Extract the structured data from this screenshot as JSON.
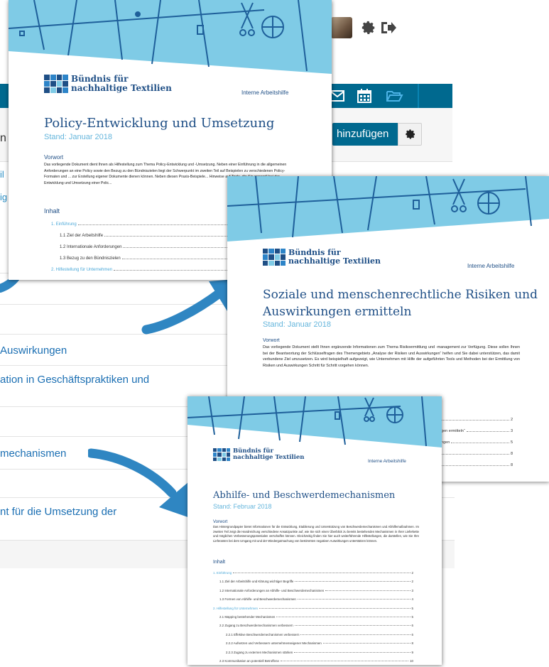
{
  "app": {
    "add_button_label": "hinzufügen",
    "frag_n": "n",
    "frag_il": "il",
    "frag_ig": "ig",
    "list_items": [
      " Auswirkungen",
      "ation in Geschäftspraktiken und",
      "mechanismen",
      "nt für die Umsetzung der"
    ],
    "icons": [
      "avatar",
      "gear-icon",
      "logout-icon",
      "mail-icon",
      "calendar-icon",
      "folder-open-icon",
      "gear-icon"
    ]
  },
  "doc1": {
    "brand_line1": "Bündnis für",
    "brand_line2": "nachhaltige Textilien",
    "label": "Interne Arbeitshilfe",
    "title": "Policy-Entwicklung und Umsetzung",
    "stand": "Stand: Januar 2018",
    "vorwort_heading": "Vorwort",
    "vorwort_text": "Das vorliegende Dokument dient Ihnen als Hilfestellung zum Thema Policy-Entwicklung und -Umsetzung. Neben einer Einführung in die allgemeinen Anforderungen an eine Policy sowie den Bezug zu den Bündniszielen liegt der Schwerpunkt im zweiten Teil auf Beispielen zu verschiedenen Policy-Formaten und ... zur Erstellung eigener Dokumente dienen können. Neben diesen Praxis-Beispiele... Hinweise auf Tools, die Sie generell bei der Entwicklung und Umsetzung einer Polic...",
    "inhalt_heading": "Inhalt",
    "toc": [
      {
        "label": "1. Einführung",
        "page": "",
        "chapter": true
      },
      {
        "label": "1.1 Ziel der Arbeitshilfe",
        "page": "",
        "chapter": false
      },
      {
        "label": "1.2 Internationale Anforderungen",
        "page": "",
        "chapter": false
      },
      {
        "label": "1.3 Bezug zu den Bündniszielen",
        "page": "",
        "chapter": false
      },
      {
        "label": "2. Hilfestellung für Unternehmen",
        "page": "",
        "chapter": true
      }
    ]
  },
  "doc2": {
    "brand_line1": "Bündnis für",
    "brand_line2": "nachhaltige Textilien",
    "label": "Interne Arbeitshilfe",
    "title_line1": "Soziale und menschenrechtliche Risiken und",
    "title_line2": "Auswirkungen ermitteln",
    "stand": "Stand: Januar 2018",
    "vorwort_heading": "Vorwort",
    "vorwort_text": "Das vorliegende Dokument stellt Ihnen ergänzende Informationen zum Thema Risikoermittlung und -management zur Verfügung. Diese sollen Ihnen bei der Beantwortung der Schlüsselfragen des Themengebiets „Analyse der Risiken und Auswirkungen“ helfen und Sie dabei unterstützen, das damit verbundene Ziel umzusetzen. Es wird beispielhaft aufgezeigt, wie Unternehmen mit Hilfe der aufgeführten Tools und Methoden bei der Ermittlung von Risiken und Auswirkungen Schritt für Schritt vorgehen können.",
    "toc_fragments": [
      {
        "label": "",
        "page": "2"
      },
      {
        "label": "ngen ermitteln“",
        "page": "3"
      },
      {
        "label": "ungen",
        "page": "5"
      },
      {
        "label": "",
        "page": "8"
      },
      {
        "label": "",
        "page": "8"
      }
    ]
  },
  "doc3": {
    "brand_line1": "Bündnis für",
    "brand_line2": "nachhaltige Textilien",
    "label": "Interne Arbeitshilfe",
    "title": "Abhilfe- und Beschwerdemechanismen",
    "stand": "Stand: Februar 2018",
    "vorwort_heading": "Vorwort",
    "vorwort_text": "Das Hintergrundpapier bietet Informationen für die Entwicklung, Etablierung und Unterstützung von Beschwerdemechanismen und Abhilfemaßnahmen. Im zweiten Teil zeigt die Handreichung verschiedene Ansatzpunkte auf, wie Sie sich einen Überblick zu bereits bestehenden Mechanismen in Ihrer Lieferkette und möglichen Verbesserungspotentialen verschaffen können. Gleichzeitig finden Sie hier auch weiterführende Hilfestellungen, die darstellen, wie Sie Ihre Lieferanten bei dem Umgang mit und der Wiedergutmachung von bestimmten negativen Auswirkungen unterstützen können.",
    "inhalt_heading": "Inhalt",
    "toc": [
      {
        "label": "1. Einführung",
        "page": "2",
        "chapter": true,
        "indent": 0
      },
      {
        "label": "1.1 Ziel der Arbeitshilfe und Klärung wichtiger Begriffe",
        "page": "2",
        "chapter": false,
        "indent": 1
      },
      {
        "label": "1.2 Internationale Anforderungen an Abhilfe- und Beschwerdemechanismen",
        "page": "3",
        "chapter": false,
        "indent": 1
      },
      {
        "label": "1.3 Formen von Abhilfe- und Beschwerdemechanismen",
        "page": "4",
        "chapter": false,
        "indent": 1
      },
      {
        "label": "2. Hilfestellung für Unternehmen",
        "page": "5",
        "chapter": true,
        "indent": 0
      },
      {
        "label": "2.1 Mapping bestehender Mechanismen",
        "page": "5",
        "chapter": false,
        "indent": 1
      },
      {
        "label": "2.2 Zugang zu Beschwerdemechanismen verbessern",
        "page": "6",
        "chapter": false,
        "indent": 1
      },
      {
        "label": "2.2.1 Effektive Beschwerdemechanismen verbessern",
        "page": "6",
        "chapter": false,
        "indent": 2
      },
      {
        "label": "2.2.2 Aufsetzen und Verbessern unternehmenseigener Mechanismen",
        "page": "8",
        "chapter": false,
        "indent": 2
      },
      {
        "label": "2.2.3 Zugang zu externen Mechanismen stärken",
        "page": "9",
        "chapter": false,
        "indent": 2
      },
      {
        "label": "2.3 Kommunikation an potentiell Betroffene",
        "page": "10",
        "chapter": false,
        "indent": 1
      }
    ]
  }
}
